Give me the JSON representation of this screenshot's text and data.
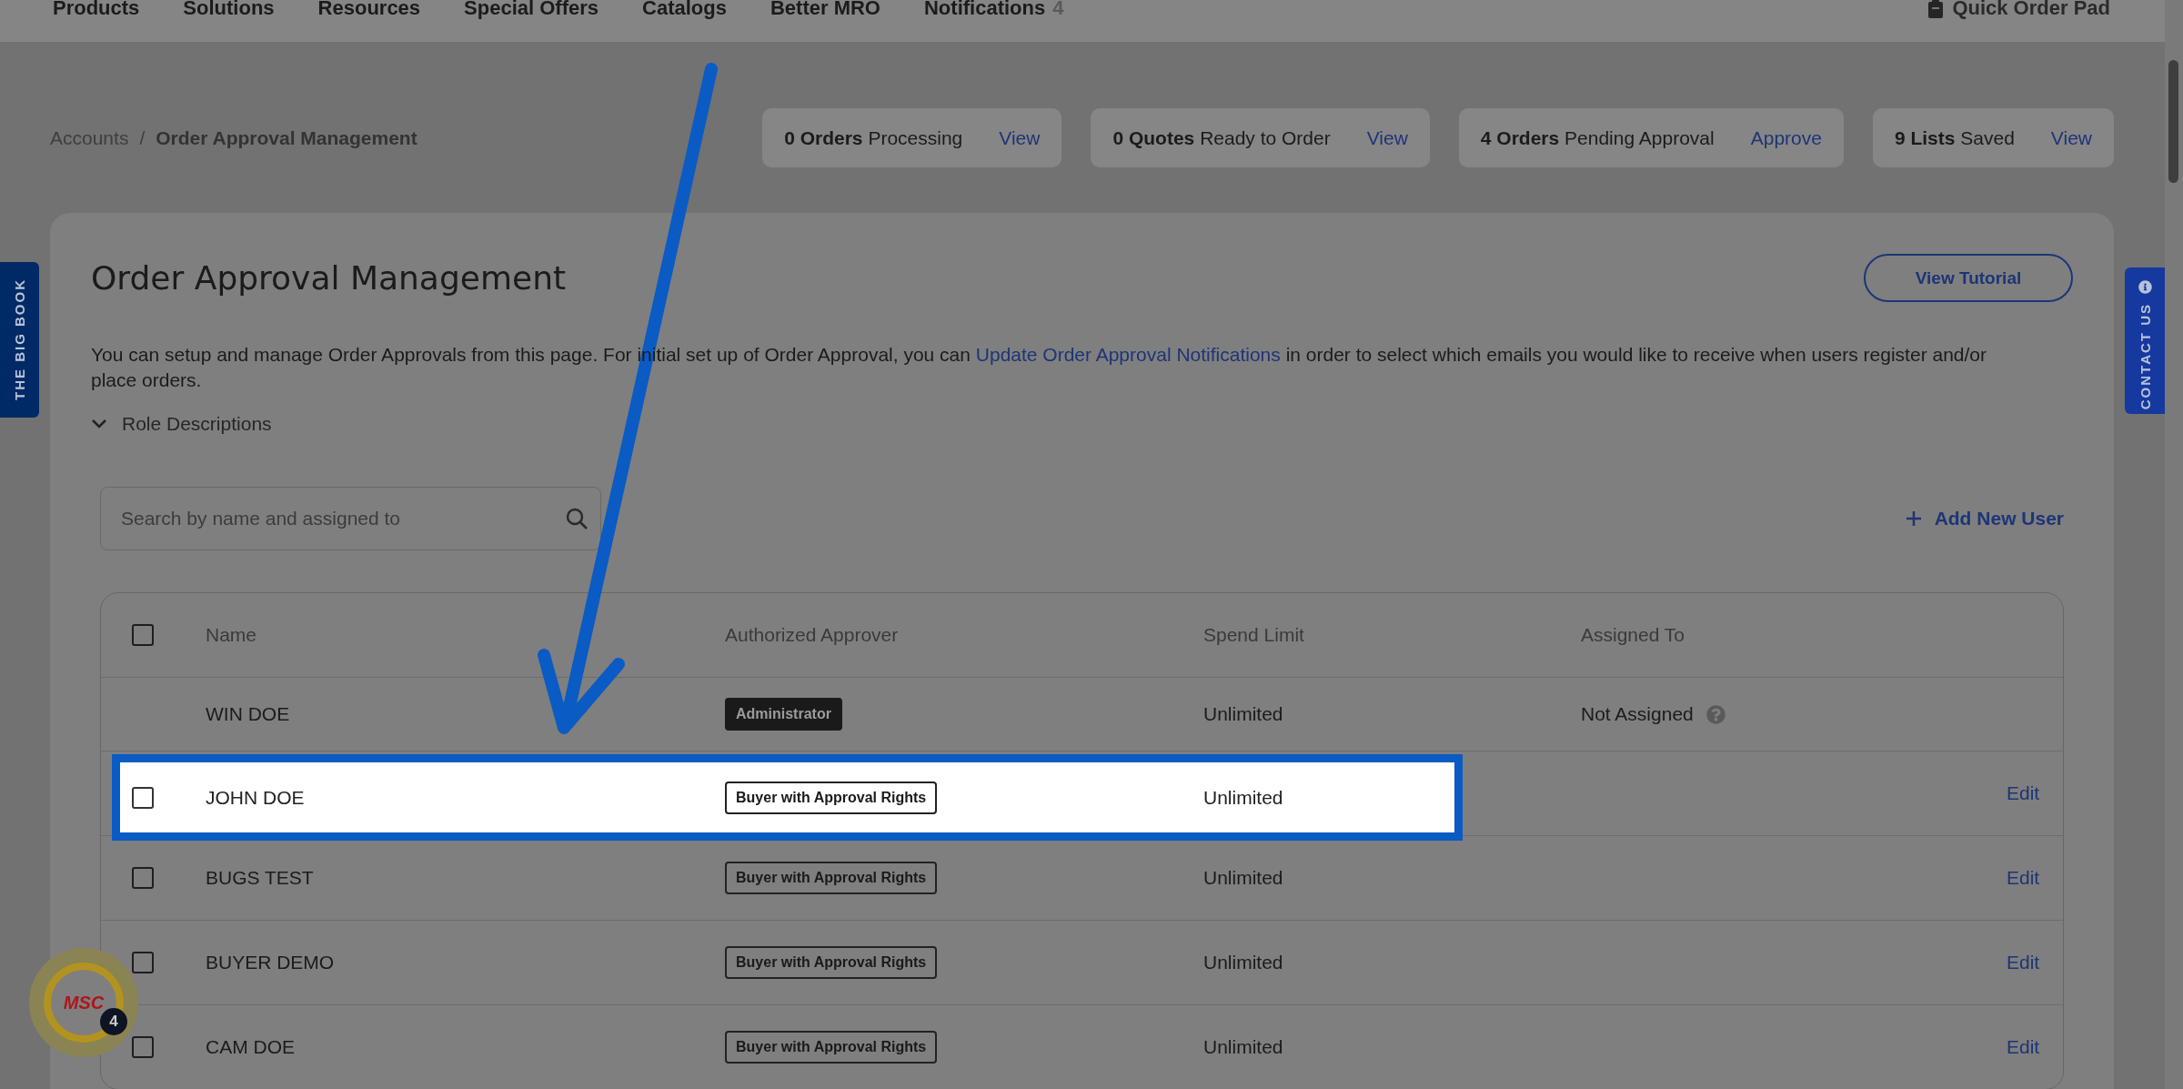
{
  "nav": {
    "items": [
      {
        "label": "Products"
      },
      {
        "label": "Solutions"
      },
      {
        "label": "Resources"
      },
      {
        "label": "Special Offers"
      },
      {
        "label": "Catalogs"
      },
      {
        "label": "Better MRO"
      },
      {
        "label": "Notifications",
        "count": "4"
      }
    ],
    "quick_order": "Quick Order Pad"
  },
  "breadcrumb": {
    "items": [
      "Accounts",
      "Order Approval Management"
    ],
    "separator": "/"
  },
  "summary": [
    {
      "strong": "0 Orders",
      "text": "Processing",
      "action": "View"
    },
    {
      "strong": "0 Quotes",
      "text": "Ready to Order",
      "action": "View"
    },
    {
      "strong": "4 Orders",
      "text": "Pending Approval",
      "action": "Approve"
    },
    {
      "strong": "9 Lists",
      "text": "Saved",
      "action": "View"
    }
  ],
  "side_tabs": {
    "left": "THE BIG BOOK",
    "right": "CONTACT US"
  },
  "title": "Order Approval Management",
  "tutorial_button": "View Tutorial",
  "intro": {
    "before": "You can setup and manage Order Approvals from this page. For initial set up of Order Approval, you can ",
    "link": "Update Order Approval Notifications",
    "after": " in order to select which emails you would like to receive when users register and/or place orders."
  },
  "role_descriptions": {
    "label": "Role Descriptions",
    "expanded": false
  },
  "search": {
    "placeholder": "Search by name and assigned to"
  },
  "add_user": "Add New User",
  "table": {
    "columns": [
      "Name",
      "Authorized Approver",
      "Spend Limit",
      "Assigned To"
    ],
    "header_checked": false,
    "rows": [
      {
        "name": "WIN DOE",
        "role": {
          "label": "Administrator",
          "kind": "admin"
        },
        "spend": "Unlimited",
        "assigned": "Not Assigned",
        "highlighted": false
      },
      {
        "checked": false,
        "name": "JOHN DOE",
        "role": {
          "label": "Buyer with Approval Rights",
          "kind": "buyer"
        },
        "spend": "Unlimited",
        "edit": "Edit",
        "highlighted": true
      },
      {
        "checked": false,
        "name": "BUGS TEST",
        "role": {
          "label": "Buyer with Approval Rights",
          "kind": "buyer"
        },
        "spend": "Unlimited",
        "edit": "Edit",
        "highlighted": false
      },
      {
        "checked": false,
        "name": "BUYER DEMO",
        "role": {
          "label": "Buyer with Approval Rights",
          "kind": "buyer"
        },
        "spend": "Unlimited",
        "edit": "Edit",
        "highlighted": false
      },
      {
        "checked": false,
        "name": "CAM DOE",
        "role": {
          "label": "Buyer with Approval Rights",
          "kind": "buyer"
        },
        "spend": "Unlimited",
        "edit": "Edit",
        "highlighted": false
      }
    ]
  },
  "assistant": {
    "logo": "MSC",
    "badge": "4"
  }
}
